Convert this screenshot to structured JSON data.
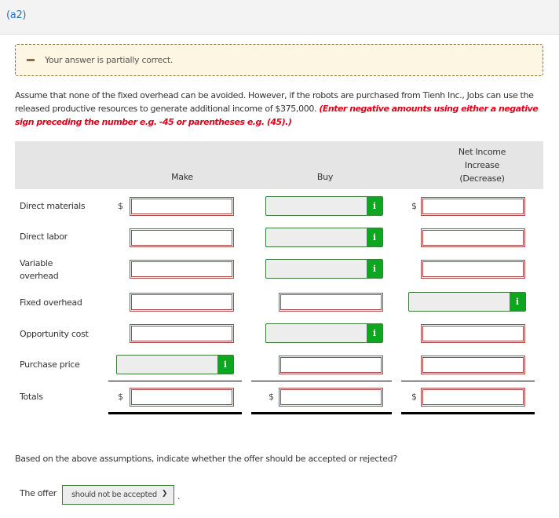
{
  "part": {
    "label": "(a2)"
  },
  "alert": {
    "icon": "minus-icon",
    "text": "Your answer is partially correct."
  },
  "question": {
    "text": "Assume that none of the fixed overhead can be avoided. However, if the robots are purchased from Tienh Inc., Jobs can use the released productive resources to generate additional income of $375,000. ",
    "hint": "(Enter negative amounts using either a negative sign preceding the number e.g. -45 or parentheses e.g. (45).)"
  },
  "table": {
    "headers": {
      "make": "Make",
      "buy": "Buy",
      "net": [
        "Net Income",
        "Increase",
        "(Decrease)"
      ]
    },
    "currency_symbol": "$",
    "info_icon_glyph": "i",
    "rows": [
      {
        "label": "Direct materials",
        "make": "",
        "buy": "",
        "net": "",
        "make_state": "incorrect",
        "buy_state": "locked",
        "net_state": "incorrect"
      },
      {
        "label": "Direct labor",
        "make": "",
        "buy": "",
        "net": "",
        "make_state": "incorrect",
        "buy_state": "locked",
        "net_state": "incorrect"
      },
      {
        "label": "Variable overhead",
        "make": "",
        "buy": "",
        "net": "",
        "make_state": "incorrect",
        "buy_state": "locked",
        "net_state": "incorrect"
      },
      {
        "label": "Fixed overhead",
        "make": "",
        "buy": "",
        "net": "",
        "make_state": "incorrect",
        "buy_state": "incorrect",
        "net_state": "locked"
      },
      {
        "label": "Opportunity cost",
        "make": "",
        "buy": "",
        "net": "",
        "make_state": "incorrect",
        "buy_state": "locked",
        "net_state": "incorrect"
      },
      {
        "label": "Purchase price",
        "make": "",
        "buy": "",
        "net": "",
        "make_state": "locked",
        "buy_state": "incorrect",
        "net_state": "incorrect"
      },
      {
        "label": "Totals",
        "make": "",
        "buy": "",
        "net": "",
        "make_state": "incorrect",
        "buy_state": "incorrect",
        "net_state": "incorrect"
      }
    ]
  },
  "followup": {
    "question": "Based on the above assumptions, indicate whether the offer should be accepted or rejected?",
    "prefix": "The offer",
    "selected": "should not be accepted",
    "suffix": "."
  }
}
